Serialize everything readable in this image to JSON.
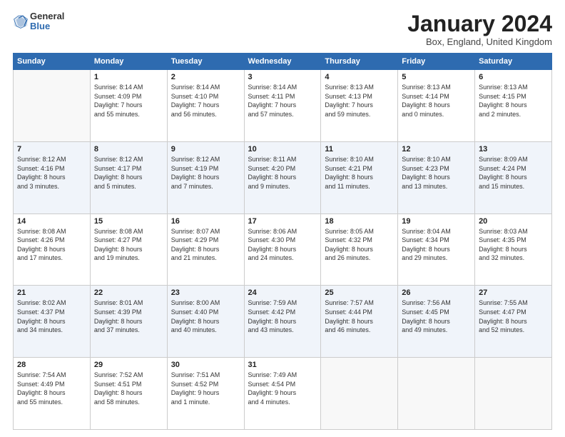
{
  "header": {
    "logo": {
      "general": "General",
      "blue": "Blue"
    },
    "title": "January 2024",
    "location": "Box, England, United Kingdom"
  },
  "weekdays": [
    "Sunday",
    "Monday",
    "Tuesday",
    "Wednesday",
    "Thursday",
    "Friday",
    "Saturday"
  ],
  "weeks": [
    [
      {
        "day": "",
        "info": ""
      },
      {
        "day": "1",
        "info": "Sunrise: 8:14 AM\nSunset: 4:09 PM\nDaylight: 7 hours\nand 55 minutes."
      },
      {
        "day": "2",
        "info": "Sunrise: 8:14 AM\nSunset: 4:10 PM\nDaylight: 7 hours\nand 56 minutes."
      },
      {
        "day": "3",
        "info": "Sunrise: 8:14 AM\nSunset: 4:11 PM\nDaylight: 7 hours\nand 57 minutes."
      },
      {
        "day": "4",
        "info": "Sunrise: 8:13 AM\nSunset: 4:13 PM\nDaylight: 7 hours\nand 59 minutes."
      },
      {
        "day": "5",
        "info": "Sunrise: 8:13 AM\nSunset: 4:14 PM\nDaylight: 8 hours\nand 0 minutes."
      },
      {
        "day": "6",
        "info": "Sunrise: 8:13 AM\nSunset: 4:15 PM\nDaylight: 8 hours\nand 2 minutes."
      }
    ],
    [
      {
        "day": "7",
        "info": "Sunrise: 8:12 AM\nSunset: 4:16 PM\nDaylight: 8 hours\nand 3 minutes."
      },
      {
        "day": "8",
        "info": "Sunrise: 8:12 AM\nSunset: 4:17 PM\nDaylight: 8 hours\nand 5 minutes."
      },
      {
        "day": "9",
        "info": "Sunrise: 8:12 AM\nSunset: 4:19 PM\nDaylight: 8 hours\nand 7 minutes."
      },
      {
        "day": "10",
        "info": "Sunrise: 8:11 AM\nSunset: 4:20 PM\nDaylight: 8 hours\nand 9 minutes."
      },
      {
        "day": "11",
        "info": "Sunrise: 8:10 AM\nSunset: 4:21 PM\nDaylight: 8 hours\nand 11 minutes."
      },
      {
        "day": "12",
        "info": "Sunrise: 8:10 AM\nSunset: 4:23 PM\nDaylight: 8 hours\nand 13 minutes."
      },
      {
        "day": "13",
        "info": "Sunrise: 8:09 AM\nSunset: 4:24 PM\nDaylight: 8 hours\nand 15 minutes."
      }
    ],
    [
      {
        "day": "14",
        "info": "Sunrise: 8:08 AM\nSunset: 4:26 PM\nDaylight: 8 hours\nand 17 minutes."
      },
      {
        "day": "15",
        "info": "Sunrise: 8:08 AM\nSunset: 4:27 PM\nDaylight: 8 hours\nand 19 minutes."
      },
      {
        "day": "16",
        "info": "Sunrise: 8:07 AM\nSunset: 4:29 PM\nDaylight: 8 hours\nand 21 minutes."
      },
      {
        "day": "17",
        "info": "Sunrise: 8:06 AM\nSunset: 4:30 PM\nDaylight: 8 hours\nand 24 minutes."
      },
      {
        "day": "18",
        "info": "Sunrise: 8:05 AM\nSunset: 4:32 PM\nDaylight: 8 hours\nand 26 minutes."
      },
      {
        "day": "19",
        "info": "Sunrise: 8:04 AM\nSunset: 4:34 PM\nDaylight: 8 hours\nand 29 minutes."
      },
      {
        "day": "20",
        "info": "Sunrise: 8:03 AM\nSunset: 4:35 PM\nDaylight: 8 hours\nand 32 minutes."
      }
    ],
    [
      {
        "day": "21",
        "info": "Sunrise: 8:02 AM\nSunset: 4:37 PM\nDaylight: 8 hours\nand 34 minutes."
      },
      {
        "day": "22",
        "info": "Sunrise: 8:01 AM\nSunset: 4:39 PM\nDaylight: 8 hours\nand 37 minutes."
      },
      {
        "day": "23",
        "info": "Sunrise: 8:00 AM\nSunset: 4:40 PM\nDaylight: 8 hours\nand 40 minutes."
      },
      {
        "day": "24",
        "info": "Sunrise: 7:59 AM\nSunset: 4:42 PM\nDaylight: 8 hours\nand 43 minutes."
      },
      {
        "day": "25",
        "info": "Sunrise: 7:57 AM\nSunset: 4:44 PM\nDaylight: 8 hours\nand 46 minutes."
      },
      {
        "day": "26",
        "info": "Sunrise: 7:56 AM\nSunset: 4:45 PM\nDaylight: 8 hours\nand 49 minutes."
      },
      {
        "day": "27",
        "info": "Sunrise: 7:55 AM\nSunset: 4:47 PM\nDaylight: 8 hours\nand 52 minutes."
      }
    ],
    [
      {
        "day": "28",
        "info": "Sunrise: 7:54 AM\nSunset: 4:49 PM\nDaylight: 8 hours\nand 55 minutes."
      },
      {
        "day": "29",
        "info": "Sunrise: 7:52 AM\nSunset: 4:51 PM\nDaylight: 8 hours\nand 58 minutes."
      },
      {
        "day": "30",
        "info": "Sunrise: 7:51 AM\nSunset: 4:52 PM\nDaylight: 9 hours\nand 1 minute."
      },
      {
        "day": "31",
        "info": "Sunrise: 7:49 AM\nSunset: 4:54 PM\nDaylight: 9 hours\nand 4 minutes."
      },
      {
        "day": "",
        "info": ""
      },
      {
        "day": "",
        "info": ""
      },
      {
        "day": "",
        "info": ""
      }
    ]
  ]
}
